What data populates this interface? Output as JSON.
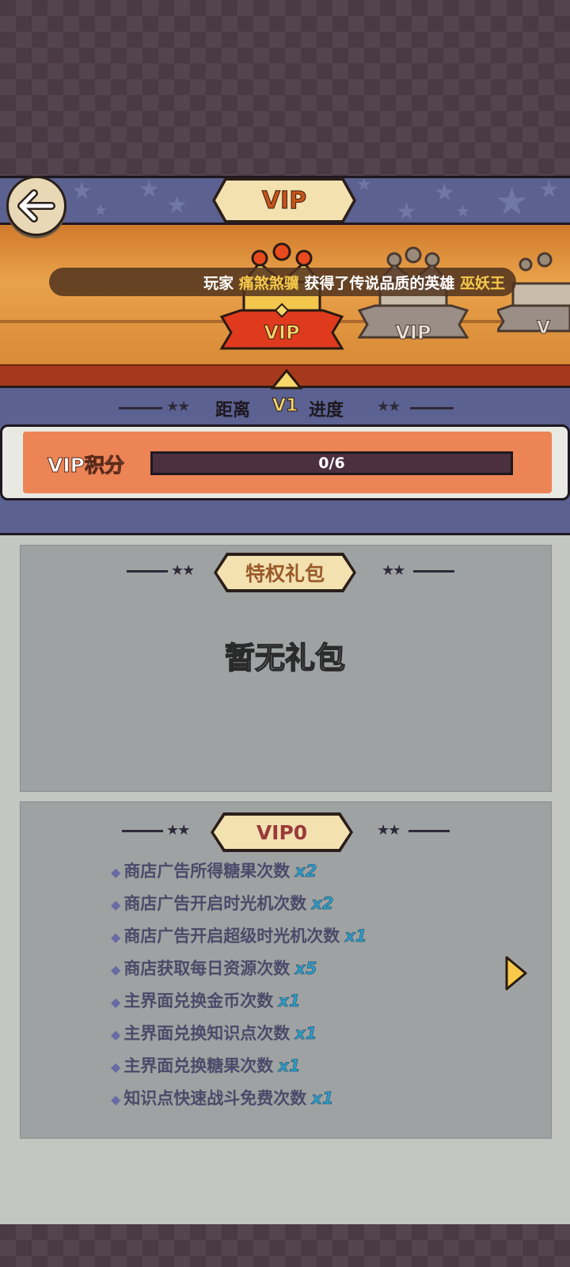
{
  "header": {
    "title": "VIP"
  },
  "banner": {
    "notice": {
      "prefix": "玩家",
      "player": "痛煞煞骥",
      "middle": "获得了传说品质的英雄",
      "hero": "巫妖王"
    },
    "crowns": [
      {
        "label": "VIP"
      },
      {
        "label": "VIP"
      },
      {
        "label": "V"
      }
    ]
  },
  "progress": {
    "heading_left": "距离",
    "level": "V1",
    "heading_right": "进度",
    "points_label": "VIP积分",
    "points_text": "0/6",
    "points_fraction": 0
  },
  "gift": {
    "title": "特权礼包",
    "empty_text": "暂无礼包"
  },
  "perks": {
    "title": "VIP0",
    "items": [
      {
        "text": "商店广告所得糖果次数",
        "mult": "x2"
      },
      {
        "text": "商店广告开启时光机次数",
        "mult": "x2"
      },
      {
        "text": "商店广告开启超级时光机次数",
        "mult": "x1"
      },
      {
        "text": "商店获取每日资源次数",
        "mult": "x5"
      },
      {
        "text": "主界面兑换金币次数",
        "mult": "x1"
      },
      {
        "text": "主界面兑换知识点次数",
        "mult": "x1"
      },
      {
        "text": "主界面兑换糖果次数",
        "mult": "x1"
      },
      {
        "text": "知识点快速战斗免费次数",
        "mult": "x1"
      }
    ]
  },
  "icons": {
    "back": "arrow-left-icon",
    "next": "chevron-right-icon"
  },
  "colors": {
    "accent": "#f7c94a",
    "bar": "#ec8456",
    "header": "#5b6190"
  }
}
